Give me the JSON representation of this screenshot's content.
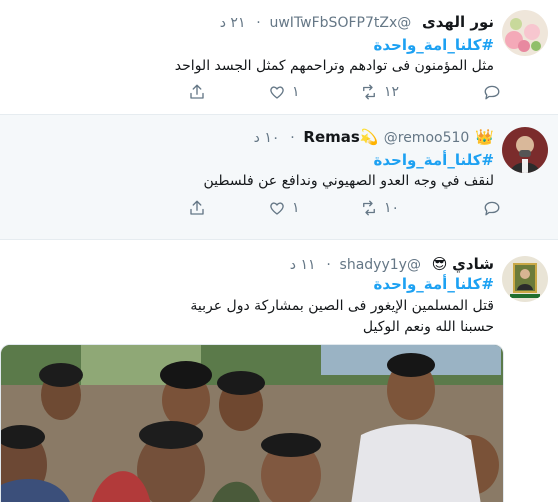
{
  "tweets": [
    {
      "name": "نور الهدى",
      "handle": "@uwITwFbSOFP7tZx",
      "time": "٢١ د",
      "hashtag": "#كلنا_امة_واحدة",
      "lines": [
        "مثل المؤمنون فى توادهم وتراحمهم كمثل الجسد الواحد"
      ],
      "counts": {
        "reply": "",
        "retweet": "١٢",
        "like": "١"
      },
      "avatar_icon": "flower-avatar"
    },
    {
      "name": "Remas",
      "name_emojis_before": "💫",
      "name_emojis_after": "👑",
      "handle": "@remoo510",
      "time": "١٠ د",
      "hashtag": "#كلنا_أمة_واحدة",
      "lines": [
        "لنقف في وجه العدو الصهيوني وندافع عن فلسطين"
      ],
      "counts": {
        "reply": "",
        "retweet": "١٠",
        "like": "١"
      },
      "avatar_icon": "man-avatar"
    },
    {
      "name": "شادي",
      "name_emoji": "😎",
      "handle": "@shadyy1y",
      "time": "١١ د",
      "hashtag": "#كلنا_أمة_واحدة",
      "lines": [
        "قتل المسلمين الإيغور فى الصين بمشاركة دول عربية",
        "حسبنا الله ونعم الوكيل"
      ],
      "avatar_icon": "portrait-avatar",
      "media_icon": "crowd-photo"
    }
  ],
  "colors": {
    "accent": "#1da1f2",
    "muted": "#657786",
    "highlight_bg": "#f5f8fa"
  },
  "icons": {
    "reply": "reply-icon",
    "retweet": "retweet-icon",
    "like": "heart-icon",
    "share": "share-icon"
  }
}
